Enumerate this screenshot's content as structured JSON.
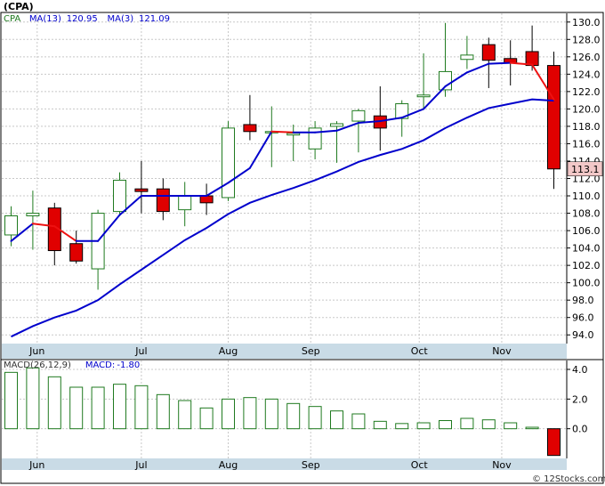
{
  "header": {
    "symbol_label": "(CPA)"
  },
  "watermark": "© 12Stocks.com",
  "colors": {
    "up": "#1f7a1f",
    "down": "#e00000",
    "ma_long": "#0000cc",
    "ma_short": "#ee1111",
    "axis_band": "#c9dbe6",
    "grid": "#c8c8c8",
    "last_price_bg": "#f2c8c8",
    "macd": "#1f7a1f"
  },
  "chart_data": [
    {
      "type": "candlestick",
      "legend": [
        {
          "label": "CPA",
          "value": "",
          "color": "#1f7a1f"
        },
        {
          "label": "MA(13)",
          "value": "120.95",
          "color": "#0000cc"
        },
        {
          "label": "MA(3)",
          "value": "121.09",
          "color": "#0000cc"
        }
      ],
      "last_price_label": "113.1",
      "ylim": [
        93,
        131
      ],
      "yticks": [
        "94.0",
        "96.0",
        "98.0",
        "100.0",
        "102.0",
        "104.0",
        "106.0",
        "108.0",
        "110.0",
        "112.0",
        "114.0",
        "116.0",
        "118.0",
        "120.0",
        "122.0",
        "124.0",
        "126.0",
        "128.0",
        "130.0"
      ],
      "x_labels": [
        {
          "label": "Jun",
          "index": 1.2
        },
        {
          "label": "Jul",
          "index": 6.0
        },
        {
          "label": "Aug",
          "index": 10.0
        },
        {
          "label": "Sep",
          "index": 13.8
        },
        {
          "label": "Oct",
          "index": 18.8
        },
        {
          "label": "Nov",
          "index": 22.6
        }
      ],
      "candles": [
        {
          "o": 105.5,
          "h": 108.8,
          "l": 104.2,
          "c": 107.7
        },
        {
          "o": 107.7,
          "h": 110.6,
          "l": 103.8,
          "c": 108.0
        },
        {
          "o": 108.6,
          "h": 109.2,
          "l": 102.0,
          "c": 103.7
        },
        {
          "o": 104.5,
          "h": 106.0,
          "l": 102.2,
          "c": 102.5
        },
        {
          "o": 101.6,
          "h": 108.4,
          "l": 99.2,
          "c": 108.0
        },
        {
          "o": 108.2,
          "h": 112.7,
          "l": 107.8,
          "c": 111.8
        },
        {
          "o": 110.8,
          "h": 114.0,
          "l": 108.0,
          "c": 110.5
        },
        {
          "o": 110.8,
          "h": 112.0,
          "l": 107.2,
          "c": 108.2
        },
        {
          "o": 108.4,
          "h": 111.6,
          "l": 106.5,
          "c": 110.0
        },
        {
          "o": 110.0,
          "h": 111.4,
          "l": 107.8,
          "c": 109.2
        },
        {
          "o": 109.8,
          "h": 118.6,
          "l": 109.4,
          "c": 117.8
        },
        {
          "o": 118.2,
          "h": 121.6,
          "l": 116.4,
          "c": 117.4
        },
        {
          "o": 117.4,
          "h": 120.3,
          "l": 113.3,
          "c": 117.4
        },
        {
          "o": 117.0,
          "h": 118.2,
          "l": 114.0,
          "c": 117.2
        },
        {
          "o": 115.4,
          "h": 118.6,
          "l": 114.2,
          "c": 117.8
        },
        {
          "o": 118.0,
          "h": 118.6,
          "l": 113.8,
          "c": 118.3
        },
        {
          "o": 118.6,
          "h": 120.0,
          "l": 115.0,
          "c": 119.8
        },
        {
          "o": 119.2,
          "h": 122.6,
          "l": 115.2,
          "c": 117.8
        },
        {
          "o": 118.9,
          "h": 121.0,
          "l": 116.8,
          "c": 120.6
        },
        {
          "o": 121.4,
          "h": 126.4,
          "l": 120.0,
          "c": 121.6
        },
        {
          "o": 122.2,
          "h": 129.9,
          "l": 121.4,
          "c": 124.3
        },
        {
          "o": 125.7,
          "h": 128.4,
          "l": 124.6,
          "c": 126.2
        },
        {
          "o": 127.4,
          "h": 128.2,
          "l": 122.4,
          "c": 125.6
        },
        {
          "o": 125.8,
          "h": 127.9,
          "l": 122.7,
          "c": 125.3
        },
        {
          "o": 126.6,
          "h": 129.6,
          "l": 124.4,
          "c": 125.0
        },
        {
          "o": 125.0,
          "h": 126.6,
          "l": 110.8,
          "c": 113.1
        }
      ],
      "series": [
        {
          "name": "MA(13)",
          "values": [
            93.8,
            95.0,
            96.0,
            96.8,
            98.0,
            99.8,
            101.5,
            103.2,
            104.9,
            106.3,
            107.9,
            109.2,
            110.1,
            110.9,
            111.8,
            112.8,
            113.9,
            114.7,
            115.4,
            116.4,
            117.8,
            119.0,
            120.1,
            120.6,
            121.1,
            120.95
          ]
        },
        {
          "name": "MA(3)",
          "values": [
            104.8,
            106.8,
            106.5,
            104.8,
            104.8,
            107.8,
            110.0,
            110.0,
            110.0,
            110.0,
            111.5,
            113.2,
            117.4,
            117.3,
            117.3,
            117.5,
            118.4,
            118.6,
            119.0,
            120.0,
            122.6,
            124.2,
            125.2,
            125.3,
            125.1,
            121.09
          ]
        }
      ]
    },
    {
      "type": "bar",
      "legend": [
        {
          "label": "MACD(26,12,9)",
          "value": "",
          "color": "#333333"
        },
        {
          "label": "MACD:",
          "value": "-1.80",
          "color": "#0000cc"
        }
      ],
      "ylim": [
        -2.0,
        4.6
      ],
      "yticks": [
        "0.0",
        "2.0",
        "4.0"
      ],
      "values": [
        3.8,
        4.1,
        3.5,
        2.8,
        2.8,
        3.0,
        2.9,
        2.3,
        1.9,
        1.4,
        2.0,
        2.1,
        2.0,
        1.7,
        1.5,
        1.2,
        1.0,
        0.5,
        0.35,
        0.4,
        0.55,
        0.7,
        0.6,
        0.4,
        0.1,
        -1.8
      ]
    }
  ]
}
